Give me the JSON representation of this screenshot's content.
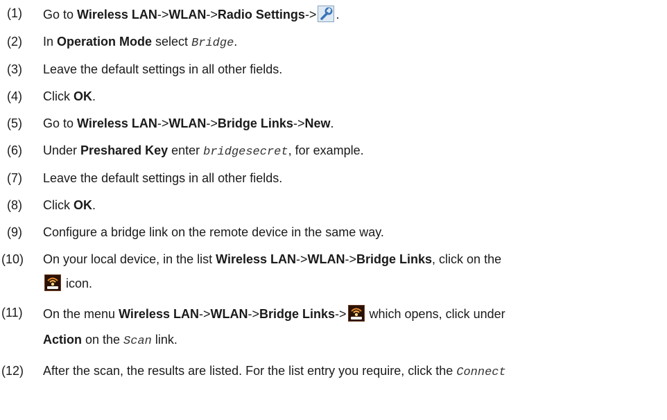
{
  "steps": [
    {
      "num": "(1)",
      "t1": "Go to ",
      "b1": "Wireless LAN",
      "t2": "->",
      "b2": "WLAN",
      "t3": "->",
      "b3": "Radio Settings",
      "t4": "->",
      "icon": "wrench-settings-icon",
      "t5": "."
    },
    {
      "num": "(2)",
      "t1": "In ",
      "b1": "Operation Mode",
      "t2": " select ",
      "m1": "Bridge",
      "t3": "."
    },
    {
      "num": "(3)",
      "t1": "Leave the default settings in all other fields."
    },
    {
      "num": "(4)",
      "t1": "Click ",
      "b1": "OK",
      "t2": "."
    },
    {
      "num": "(5)",
      "t1": "Go to ",
      "b1": "Wireless LAN",
      "t2": "->",
      "b2": "WLAN",
      "t3": "->",
      "b3": "Bridge Links",
      "t4": "->",
      "b4": "New",
      "t5": "."
    },
    {
      "num": "(6)",
      "t1": "Under ",
      "b1": "Preshared Key",
      "t2": " enter ",
      "m1": "bridgesecret",
      "t3": ", for example."
    },
    {
      "num": "(7)",
      "t1": "Leave the default settings in all other fields."
    },
    {
      "num": "(8)",
      "t1": "Click ",
      "b1": "OK",
      "t2": "."
    },
    {
      "num": "(9)",
      "t1": "Configure a bridge link on the remote device in the same way."
    },
    {
      "num": "(10)",
      "t1": "On your local device, in the list ",
      "b1": "Wireless LAN",
      "t2": "->",
      "b2": "WLAN",
      "t3": "->",
      "b3": "Bridge Links",
      "t4": ", click on the",
      "icon": "bridge-scan-icon",
      "t5": " icon."
    },
    {
      "num": "(11)",
      "t1": "On the menu ",
      "b1": "Wireless LAN",
      "t2": "->",
      "b2": "WLAN",
      "t3": "->",
      "b3": "Bridge Links",
      "t4": "->",
      "icon": "bridge-scan-icon",
      "t5": " which opens, click under",
      "b4": "Action",
      "t6": " on the ",
      "m1": "Scan",
      "t7": " link."
    },
    {
      "num": "(12)",
      "t1": "After the scan, the results are listed. For the list entry you require, click the ",
      "m1": "Connect"
    }
  ]
}
